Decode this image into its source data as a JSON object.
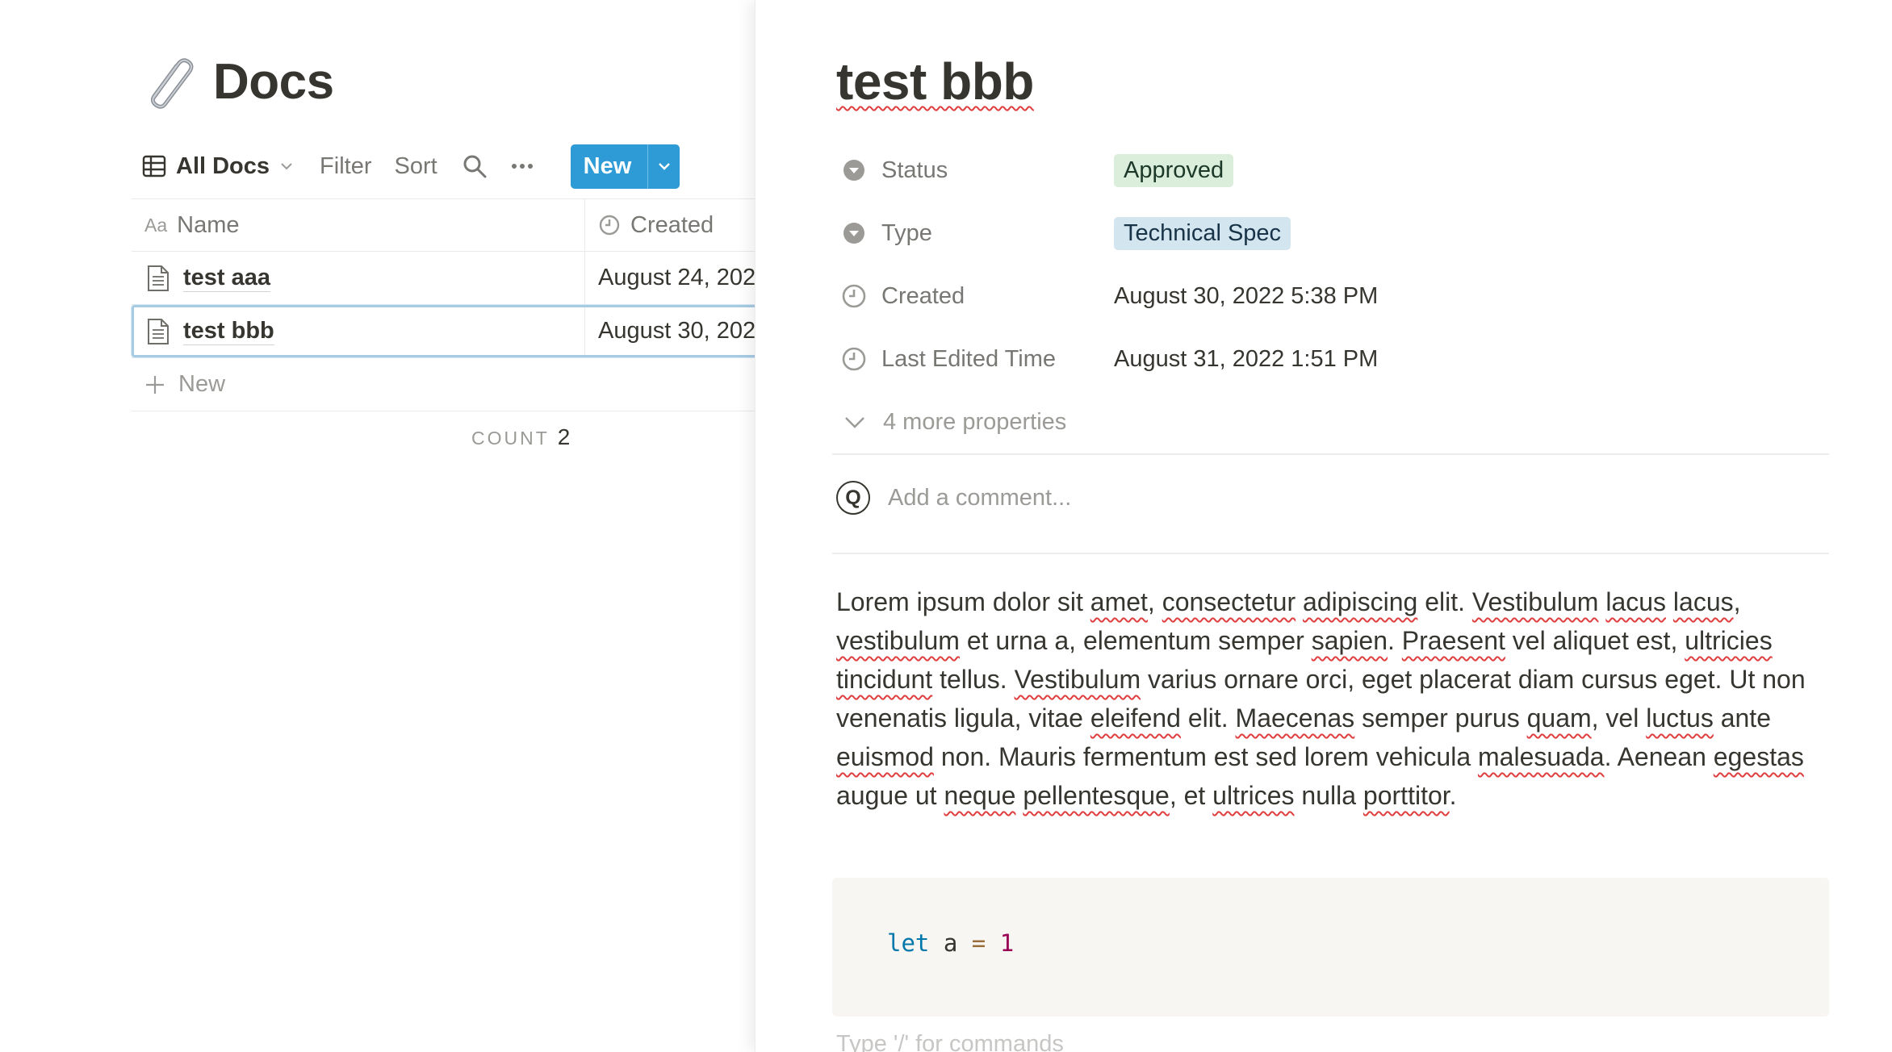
{
  "database": {
    "title": "Docs",
    "icon": "paperclip-icon",
    "toolbar": {
      "view_label": "All Docs",
      "filter_label": "Filter",
      "sort_label": "Sort",
      "new_label": "New"
    },
    "columns": {
      "name": "Name",
      "created": "Created"
    },
    "rows": [
      {
        "name": "test aaa",
        "created": "August 24, 202"
      },
      {
        "name": "test bbb",
        "created": "August 30, 202"
      }
    ],
    "new_row_label": "New",
    "count_label": "COUNT",
    "count_value": "2",
    "accent_color": "#2e9bd6"
  },
  "page": {
    "title": "test bbb",
    "properties": [
      {
        "key": "Status",
        "value": "Approved"
      },
      {
        "key": "Type",
        "value": "Technical Spec"
      },
      {
        "key": "Created",
        "value": "August 30, 2022 5:38 PM"
      },
      {
        "key": "Last Edited Time",
        "value": "August 31, 2022 1:51 PM"
      }
    ],
    "more_properties": "4 more properties",
    "comment": {
      "avatar_letter": "Q",
      "placeholder": "Add a comment..."
    },
    "body_words": [
      [
        "Lorem ipsum dolor sit ",
        false
      ],
      [
        "amet",
        true
      ],
      [
        ", ",
        false
      ],
      [
        "consectetur",
        true
      ],
      [
        " ",
        false
      ],
      [
        "adipiscing",
        true
      ],
      [
        " elit. ",
        false
      ],
      [
        "Vestibulum",
        true
      ],
      [
        " ",
        false
      ],
      [
        "lacus",
        true
      ],
      [
        " ",
        false
      ],
      [
        "lacus",
        true
      ],
      [
        ", ",
        false
      ],
      [
        "vestibulum",
        true
      ],
      [
        " et urna a, elementum semper ",
        false
      ],
      [
        "sapien",
        true
      ],
      [
        ". ",
        false
      ],
      [
        "Praesent",
        true
      ],
      [
        " vel aliquet est, ",
        false
      ],
      [
        "ultricies",
        true
      ],
      [
        " ",
        false
      ],
      [
        "tincidunt",
        true
      ],
      [
        " tellus. ",
        false
      ],
      [
        "Vestibulum",
        true
      ],
      [
        " varius ornare orci, eget placerat diam cursus eget. Ut non venenatis ligula, vitae ",
        false
      ],
      [
        "eleifend",
        true
      ],
      [
        " elit. ",
        false
      ],
      [
        "Maecenas",
        true
      ],
      [
        " semper purus ",
        false
      ],
      [
        "quam",
        true
      ],
      [
        ", vel ",
        false
      ],
      [
        "luctus",
        true
      ],
      [
        " ante ",
        false
      ],
      [
        "euismod",
        true
      ],
      [
        " non. Mauris fermentum est sed lorem vehicula ",
        false
      ],
      [
        "malesuada",
        true
      ],
      [
        ". Aenean ",
        false
      ],
      [
        "egestas",
        true
      ],
      [
        " augue ut ",
        false
      ],
      [
        "neque",
        true
      ],
      [
        " ",
        false
      ],
      [
        "pellentesque",
        true
      ],
      [
        ", et ",
        false
      ],
      [
        "ultrices",
        true
      ],
      [
        " nulla ",
        false
      ],
      [
        "porttitor",
        true
      ],
      [
        ".",
        false
      ]
    ],
    "code": {
      "keyword": "let",
      "ident": "a",
      "operator": "=",
      "number": "1"
    },
    "command_placeholder": "Type '/' for commands"
  }
}
